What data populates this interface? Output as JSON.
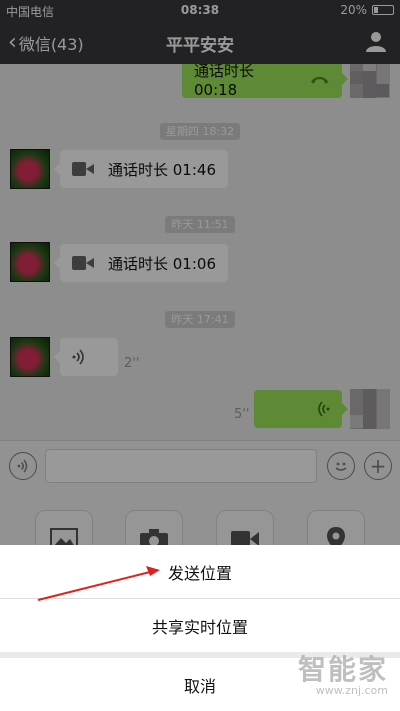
{
  "status_bar": {
    "carrier": "中国电信",
    "time": "08:38",
    "battery": "20%"
  },
  "nav": {
    "back_label": "微信(43)",
    "title": "平平安安"
  },
  "chat": {
    "messages": [
      {
        "side": "right",
        "type": "call",
        "text": "通话时长 00:18"
      },
      {
        "type": "timestamp",
        "text": "星期四 18:32"
      },
      {
        "side": "left",
        "type": "video_call",
        "text": "通话时长 01:46"
      },
      {
        "type": "timestamp",
        "text": "昨天 11:51"
      },
      {
        "side": "left",
        "type": "video_call",
        "text": "通话时长 01:06"
      },
      {
        "type": "timestamp",
        "text": "昨天 17:41"
      },
      {
        "side": "left",
        "type": "voice",
        "duration": "2''"
      },
      {
        "side": "right",
        "type": "voice",
        "duration": "5''"
      }
    ]
  },
  "action_sheet": {
    "send_location": "发送位置",
    "share_live_location": "共享实时位置",
    "cancel": "取消"
  },
  "watermark": {
    "brand": "智能家",
    "url": "www.znj.com"
  },
  "colors": {
    "nav_bg": "#393a3f",
    "bubble_green": "#9ee759",
    "annotation_red": "#e02020"
  }
}
